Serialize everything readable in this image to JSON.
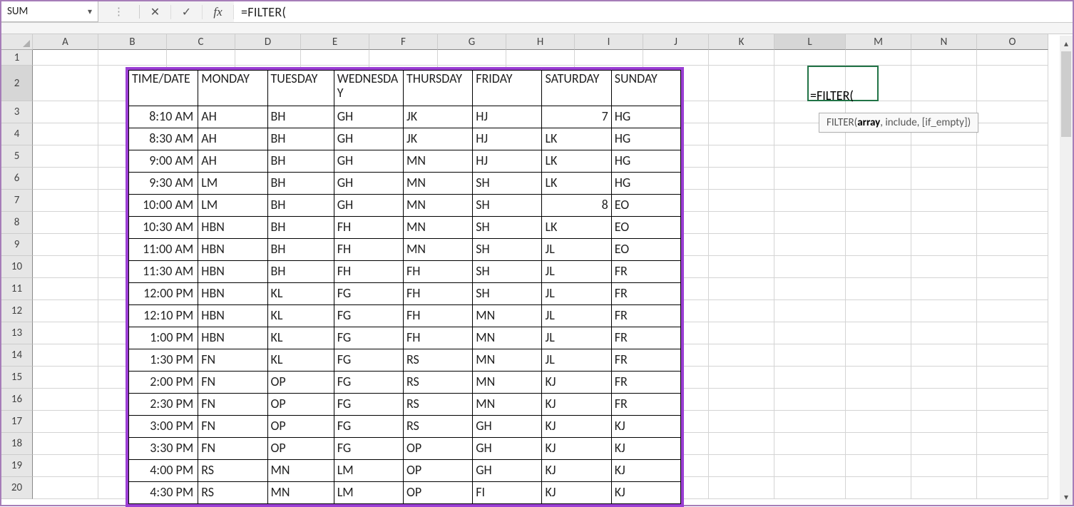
{
  "name_box": "SUM",
  "formula_bar": "=FILTER(",
  "fx_label": "fx",
  "active_cell_text": "=FILTER(",
  "tooltip_html": {
    "fn": "FILTER(",
    "bold": "array",
    "rest": ", include, [if_empty])"
  },
  "cols": [
    "A",
    "B",
    "C",
    "D",
    "E",
    "F",
    "G",
    "H",
    "I",
    "J",
    "K",
    "L",
    "M",
    "N",
    "O"
  ],
  "col_classes": [
    "cA",
    "cB",
    "cC",
    "cD",
    "cE",
    "cF",
    "cG",
    "cH",
    "cI",
    "cJ",
    "cK",
    "cL",
    "cM",
    "cN",
    "cO"
  ],
  "rows": [
    1,
    2,
    3,
    4,
    5,
    6,
    7,
    8,
    9,
    10,
    11,
    12,
    13,
    14,
    15,
    16,
    17,
    18,
    19,
    20
  ],
  "active_col": "L",
  "active_row": 2,
  "table": {
    "headers": [
      "TIME/DATE",
      "MONDAY",
      "TUESDAY",
      "WEDNESDAY",
      "THURSDAY",
      "FRIDAY",
      "SATURDAY",
      "SUNDAY"
    ],
    "rows": [
      {
        "time": "8:10 AM",
        "mon": "AH",
        "tue": "BH",
        "wed": "GH",
        "thu": "JK",
        "fri": "HJ",
        "sat": "7",
        "sat_right": true,
        "sun": "HG"
      },
      {
        "time": "8:30 AM",
        "mon": "AH",
        "tue": "BH",
        "wed": "GH",
        "thu": "JK",
        "fri": "HJ",
        "sat": "LK",
        "sun": "HG"
      },
      {
        "time": "9:00 AM",
        "mon": "AH",
        "tue": "BH",
        "wed": "GH",
        "thu": "MN",
        "fri": "HJ",
        "sat": "LK",
        "sun": "HG"
      },
      {
        "time": "9:30 AM",
        "mon": "LM",
        "tue": "BH",
        "wed": "GH",
        "thu": "MN",
        "fri": "SH",
        "sat": "LK",
        "sun": "HG"
      },
      {
        "time": "10:00 AM",
        "mon": "LM",
        "tue": "BH",
        "wed": "GH",
        "thu": "MN",
        "fri": "SH",
        "sat": "8",
        "sat_right": true,
        "sun": "EO"
      },
      {
        "time": "10:30 AM",
        "mon": "HBN",
        "tue": "BH",
        "wed": "FH",
        "thu": "MN",
        "fri": "SH",
        "sat": "LK",
        "sun": "EO"
      },
      {
        "time": "11:00 AM",
        "mon": "HBN",
        "tue": "BH",
        "wed": "FH",
        "thu": "MN",
        "fri": "SH",
        "sat": "JL",
        "sun": "EO"
      },
      {
        "time": "11:30 AM",
        "mon": "HBN",
        "tue": "BH",
        "wed": "FH",
        "thu": "FH",
        "fri": "SH",
        "sat": "JL",
        "sun": "FR"
      },
      {
        "time": "12:00 PM",
        "mon": "HBN",
        "tue": "KL",
        "wed": "FG",
        "thu": "FH",
        "fri": "SH",
        "sat": "JL",
        "sun": "FR"
      },
      {
        "time": "12:10 PM",
        "mon": "HBN",
        "tue": "KL",
        "wed": "FG",
        "thu": "FH",
        "fri": "MN",
        "sat": "JL",
        "sun": "FR"
      },
      {
        "time": "1:00 PM",
        "mon": "HBN",
        "tue": "KL",
        "wed": "FG",
        "thu": "FH",
        "fri": "MN",
        "sat": "JL",
        "sun": "FR"
      },
      {
        "time": "1:30 PM",
        "mon": "FN",
        "tue": "KL",
        "wed": "FG",
        "thu": "RS",
        "fri": "MN",
        "sat": "JL",
        "sun": "FR"
      },
      {
        "time": "2:00 PM",
        "mon": "FN",
        "tue": "OP",
        "wed": "FG",
        "thu": "RS",
        "fri": "MN",
        "sat": "KJ",
        "sun": "FR"
      },
      {
        "time": "2:30 PM",
        "mon": "FN",
        "tue": "OP",
        "wed": "FG",
        "thu": "RS",
        "fri": "MN",
        "sat": "KJ",
        "sun": "FR"
      },
      {
        "time": "3:00 PM",
        "mon": "FN",
        "tue": "OP",
        "wed": "FG",
        "thu": "RS",
        "fri": "GH",
        "sat": "KJ",
        "sun": "KJ"
      },
      {
        "time": "3:30 PM",
        "mon": "FN",
        "tue": "OP",
        "wed": "FG",
        "thu": "OP",
        "fri": "GH",
        "sat": "KJ",
        "sun": "KJ"
      },
      {
        "time": "4:00 PM",
        "mon": "RS",
        "tue": "MN",
        "wed": "LM",
        "thu": "OP",
        "fri": "GH",
        "sat": "KJ",
        "sun": "KJ"
      },
      {
        "time": "4:30 PM",
        "mon": "RS",
        "tue": "MN",
        "wed": "LM",
        "thu": "OP",
        "fri": "FI",
        "sat": "KJ",
        "sun": "KJ"
      }
    ]
  }
}
